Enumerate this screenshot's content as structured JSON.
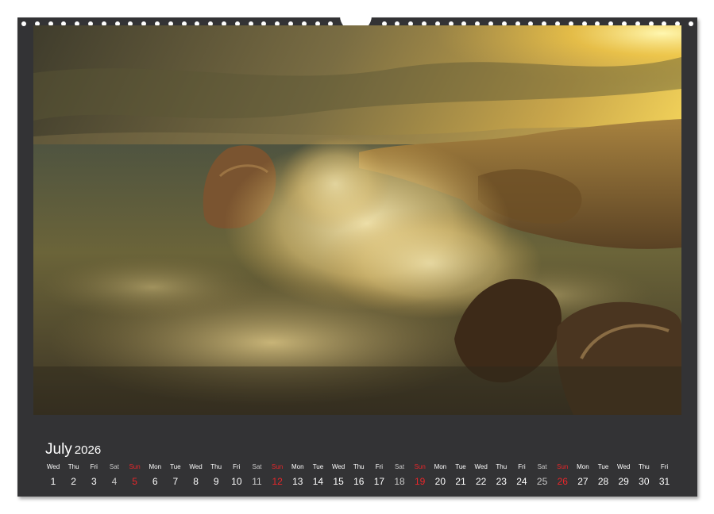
{
  "calendar": {
    "month": "July",
    "year": "2026",
    "days": [
      {
        "dow": "Wed",
        "num": "1"
      },
      {
        "dow": "Thu",
        "num": "2"
      },
      {
        "dow": "Fri",
        "num": "3"
      },
      {
        "dow": "Sat",
        "num": "4"
      },
      {
        "dow": "Sun",
        "num": "5"
      },
      {
        "dow": "Mon",
        "num": "6"
      },
      {
        "dow": "Tue",
        "num": "7"
      },
      {
        "dow": "Wed",
        "num": "8"
      },
      {
        "dow": "Thu",
        "num": "9"
      },
      {
        "dow": "Fri",
        "num": "10"
      },
      {
        "dow": "Sat",
        "num": "11"
      },
      {
        "dow": "Sun",
        "num": "12"
      },
      {
        "dow": "Mon",
        "num": "13"
      },
      {
        "dow": "Tue",
        "num": "14"
      },
      {
        "dow": "Wed",
        "num": "15"
      },
      {
        "dow": "Thu",
        "num": "16"
      },
      {
        "dow": "Fri",
        "num": "17"
      },
      {
        "dow": "Sat",
        "num": "18"
      },
      {
        "dow": "Sun",
        "num": "19"
      },
      {
        "dow": "Mon",
        "num": "20"
      },
      {
        "dow": "Tue",
        "num": "21"
      },
      {
        "dow": "Wed",
        "num": "22"
      },
      {
        "dow": "Thu",
        "num": "23"
      },
      {
        "dow": "Fri",
        "num": "24"
      },
      {
        "dow": "Sat",
        "num": "25"
      },
      {
        "dow": "Sun",
        "num": "26"
      },
      {
        "dow": "Mon",
        "num": "27"
      },
      {
        "dow": "Tue",
        "num": "28"
      },
      {
        "dow": "Wed",
        "num": "29"
      },
      {
        "dow": "Thu",
        "num": "30"
      },
      {
        "dow": "Fri",
        "num": "31"
      }
    ]
  },
  "colors": {
    "sheet_background": "#333335",
    "text": "#ffffff",
    "sunday": "#e8262a"
  },
  "photo": {
    "icon": "seascape-photo"
  }
}
